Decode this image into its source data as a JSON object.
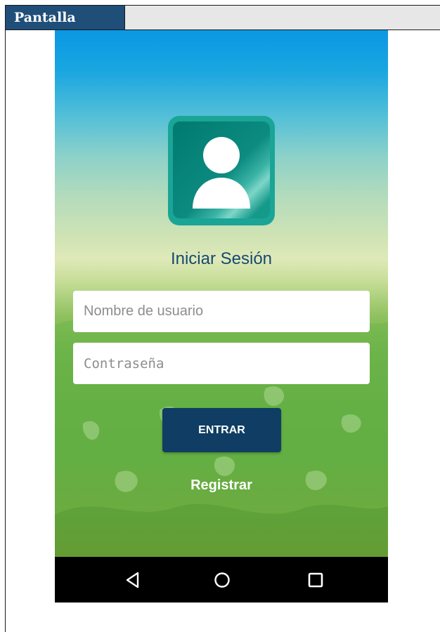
{
  "document": {
    "header_label": "Pantalla",
    "header_color": "#1f4e79"
  },
  "screen": {
    "title": "Iniciar Sesión",
    "username_placeholder": "Nombre de usuario",
    "password_placeholder": "Contraseña",
    "enter_label": "ENTRAR",
    "register_label": "Registrar",
    "accent_color": "#0f3d63",
    "icon": "user-avatar-icon"
  },
  "navbar": {
    "back_icon": "back-triangle-icon",
    "home_icon": "home-circle-icon",
    "recents_icon": "recents-square-icon"
  }
}
